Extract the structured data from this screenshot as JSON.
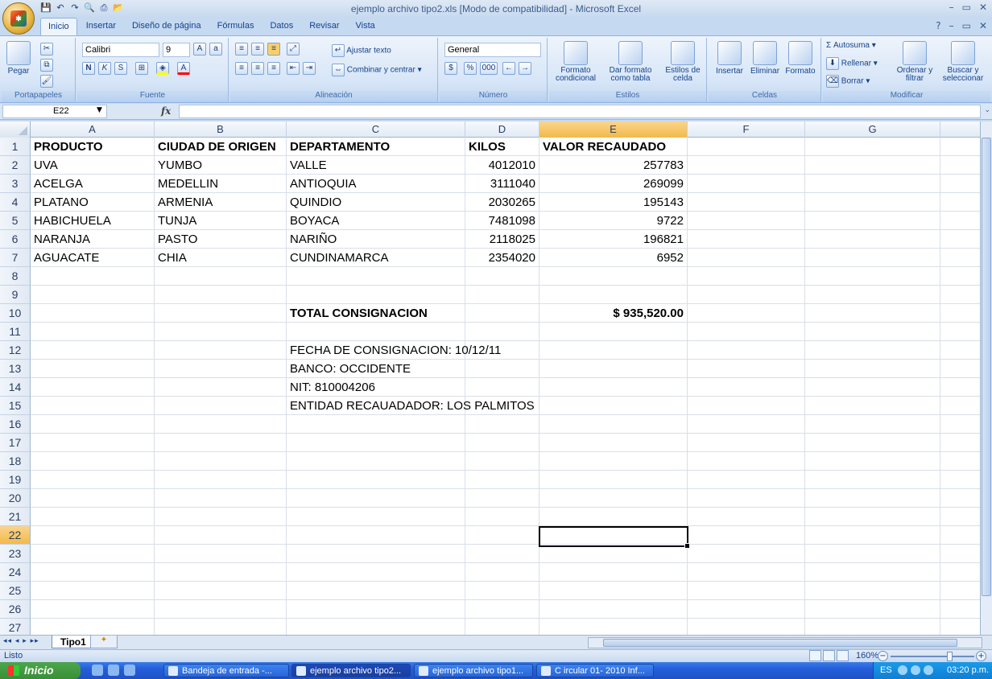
{
  "window": {
    "title": "ejemplo archivo tipo2.xls  [Modo de compatibilidad] - Microsoft Excel",
    "controls": [
      "–",
      "▭",
      "✕"
    ],
    "doc_controls": [
      "?",
      "–",
      "▭",
      "✕"
    ]
  },
  "quick_access": [
    "save-icon",
    "undo-icon",
    "redo-icon",
    "print-preview-icon",
    "print-icon",
    "open-icon"
  ],
  "tabs": [
    {
      "label": "Inicio",
      "active": true
    },
    {
      "label": "Insertar"
    },
    {
      "label": "Diseño de página"
    },
    {
      "label": "Fórmulas"
    },
    {
      "label": "Datos"
    },
    {
      "label": "Revisar"
    },
    {
      "label": "Vista"
    }
  ],
  "ribbon": {
    "portapapeles": {
      "label": "Portapapeles",
      "paste": "Pegar"
    },
    "fuente": {
      "label": "Fuente",
      "font_name": "Calibri",
      "font_size": "9",
      "bold": "N",
      "italic": "K",
      "underline": "S"
    },
    "alineacion": {
      "label": "Alineación",
      "wrap": "Ajustar texto",
      "merge": "Combinar y centrar"
    },
    "numero": {
      "label": "Número",
      "format": "General",
      "currency": "$",
      "percent": "%",
      "thousands": "000"
    },
    "estilos": {
      "label": "Estilos",
      "cond": "Formato condicional",
      "table": "Dar formato como tabla",
      "cell_styles": "Estilos de celda"
    },
    "celdas": {
      "label": "Celdas",
      "insert": "Insertar",
      "delete": "Eliminar",
      "format": "Formato"
    },
    "modificar": {
      "label": "Modificar",
      "autosum": "Autosuma",
      "fill": "Rellenar",
      "clear": "Borrar",
      "sort": "Ordenar y filtrar",
      "find": "Buscar y seleccionar"
    }
  },
  "formula_bar": {
    "name_box": "E22",
    "fx": "fx",
    "value": ""
  },
  "columns": [
    {
      "label": "A"
    },
    {
      "label": "B"
    },
    {
      "label": "C"
    },
    {
      "label": "D"
    },
    {
      "label": "E",
      "selected": true
    },
    {
      "label": "F"
    },
    {
      "label": "G"
    }
  ],
  "rows": [
    {
      "n": "1",
      "cells": {
        "A": "PRODUCTO",
        "B": "CIUDAD DE ORIGEN",
        "C": "DEPARTAMENTO",
        "D": "KILOS",
        "E": "VALOR RECAUDADO"
      },
      "bold": true
    },
    {
      "n": "2",
      "cells": {
        "A": "UVA",
        "B": "YUMBO",
        "C": "VALLE",
        "D": "4012010",
        "E": "257783"
      }
    },
    {
      "n": "3",
      "cells": {
        "A": "ACELGA",
        "B": "MEDELLIN",
        "C": "ANTIOQUIA",
        "D": "3111040",
        "E": "269099"
      }
    },
    {
      "n": "4",
      "cells": {
        "A": "PLATANO",
        "B": "ARMENIA",
        "C": "QUINDIO",
        "D": "2030265",
        "E": "195143"
      }
    },
    {
      "n": "5",
      "cells": {
        "A": "HABICHUELA",
        "B": "TUNJA",
        "C": "BOYACA",
        "D": "7481098",
        "E": "9722"
      }
    },
    {
      "n": "6",
      "cells": {
        "A": "NARANJA",
        "B": "PASTO",
        "C": "NARIÑO",
        "D": "2118025",
        "E": "196821"
      }
    },
    {
      "n": "7",
      "cells": {
        "A": "AGUACATE",
        "B": "CHIA",
        "C": "CUNDINAMARCA",
        "D": "2354020",
        "E": "6952"
      }
    },
    {
      "n": "8",
      "cells": {}
    },
    {
      "n": "9",
      "cells": {}
    },
    {
      "n": "10",
      "cells": {
        "C": "TOTAL CONSIGNACION",
        "E": "$ 935,520.00"
      },
      "bold": true
    },
    {
      "n": "11",
      "cells": {}
    },
    {
      "n": "12",
      "cells": {
        "C": "FECHA DE CONSIGNACION: 10/12/11"
      }
    },
    {
      "n": "13",
      "cells": {
        "C": "BANCO: OCCIDENTE"
      }
    },
    {
      "n": "14",
      "cells": {
        "C": "NIT: 810004206"
      }
    },
    {
      "n": "15",
      "cells": {
        "C": "ENTIDAD RECAUADADOR: LOS PALMITOS"
      }
    },
    {
      "n": "16",
      "cells": {}
    },
    {
      "n": "17",
      "cells": {}
    },
    {
      "n": "18",
      "cells": {}
    },
    {
      "n": "19",
      "cells": {}
    },
    {
      "n": "20",
      "cells": {}
    },
    {
      "n": "21",
      "cells": {}
    },
    {
      "n": "22",
      "cells": {},
      "selected": true
    },
    {
      "n": "23",
      "cells": {}
    },
    {
      "n": "24",
      "cells": {}
    },
    {
      "n": "25",
      "cells": {}
    },
    {
      "n": "26",
      "cells": {}
    },
    {
      "n": "27",
      "cells": {}
    }
  ],
  "selected_cell": "E22",
  "sheet_tabs": [
    {
      "label": "Tipo1",
      "active": true
    }
  ],
  "status": {
    "text": "Listo",
    "zoom": "160%"
  },
  "taskbar": {
    "start": "Inicio",
    "tasks": [
      {
        "label": "Bandeja de entrada -..."
      },
      {
        "label": "ejemplo archivo tipo2...",
        "active": true
      },
      {
        "label": "ejemplo archivo tipo1..."
      },
      {
        "label": "C ircular 01- 2010 Inf..."
      }
    ],
    "lang": "ES",
    "clock": "03:20 p.m."
  },
  "colors": {
    "accent": "#15428b",
    "selected_header": "#f3b94a",
    "taskbar": "#245edb",
    "start": "#3a8f37"
  }
}
